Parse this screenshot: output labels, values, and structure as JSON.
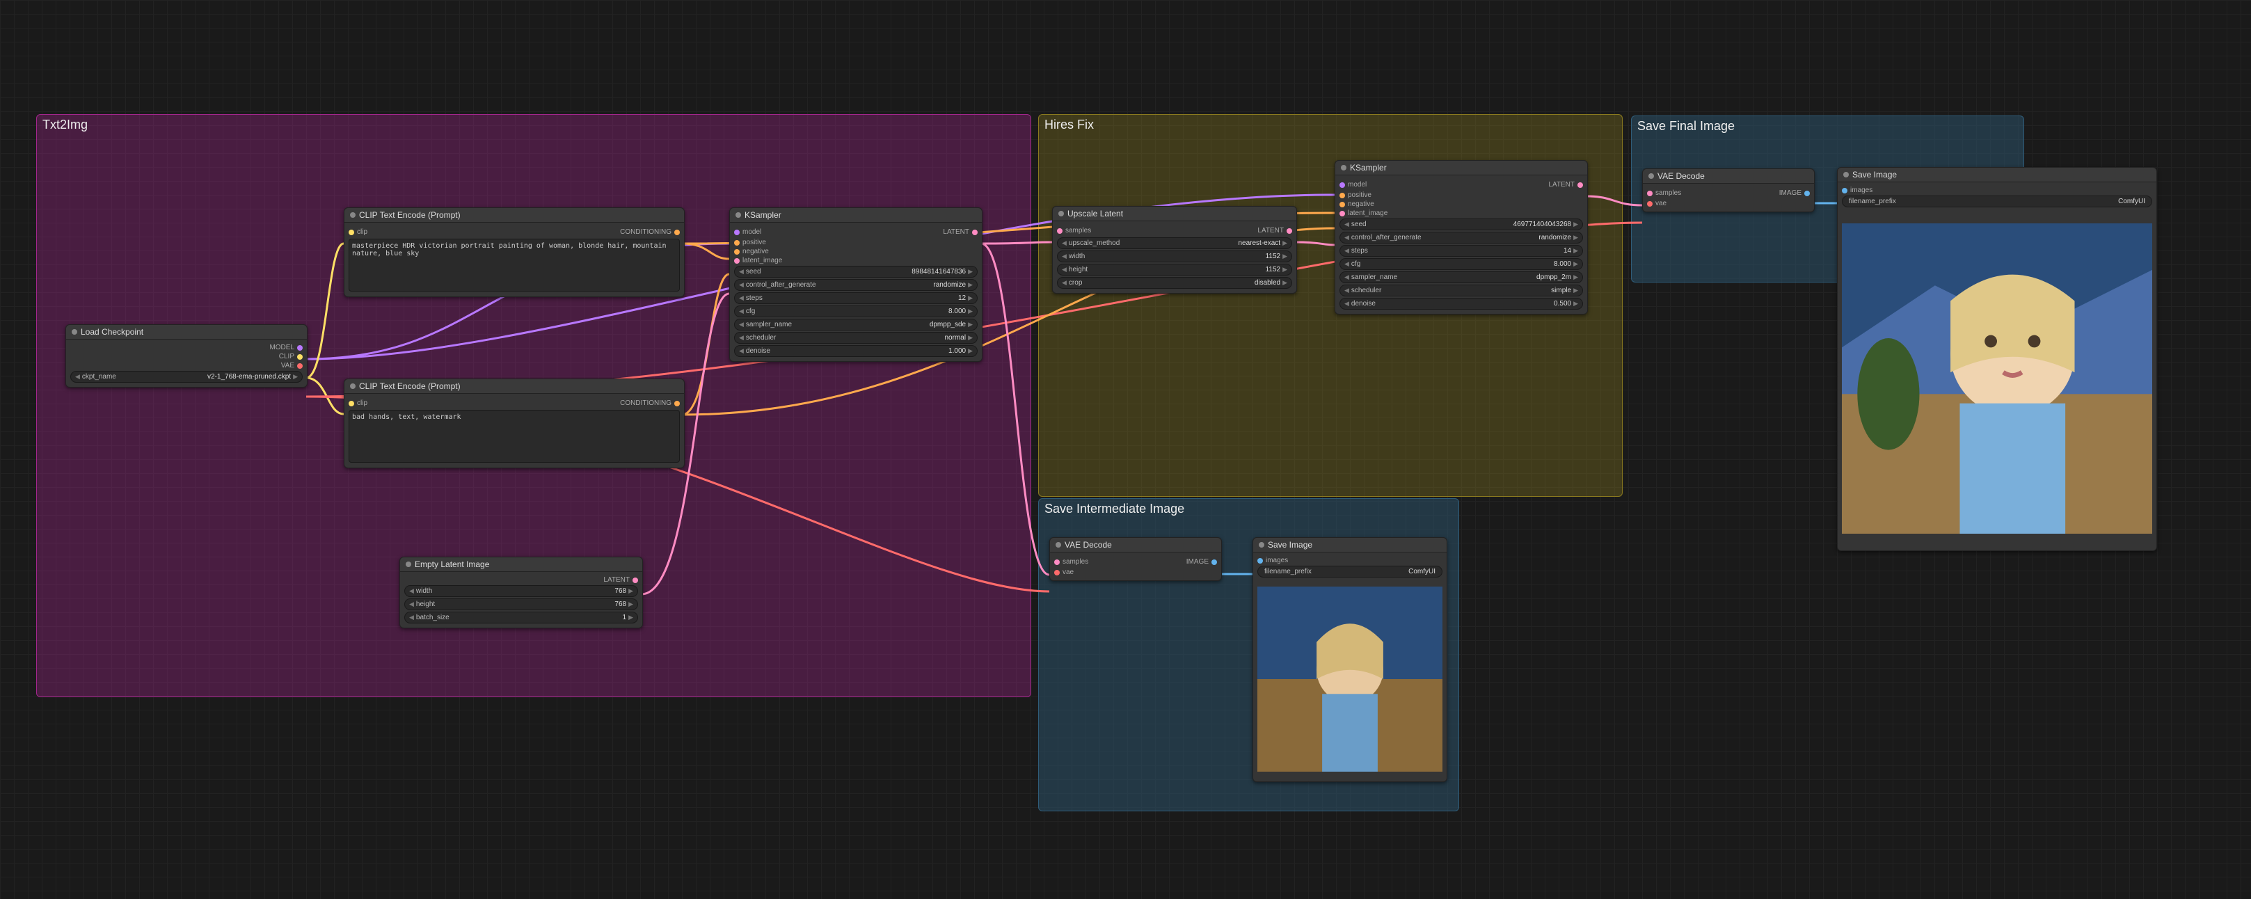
{
  "groups": {
    "txt2img": {
      "label": "Txt2Img",
      "color": "#a3268c"
    },
    "hiresfix": {
      "label": "Hires Fix",
      "color": "#8a7a1f"
    },
    "save_int": {
      "label": "Save Intermediate Image",
      "color": "#2f5d7a"
    },
    "save_final": {
      "label": "Save Final Image",
      "color": "#2f5d7a"
    }
  },
  "nodes": {
    "load_ckpt": {
      "title": "Load Checkpoint",
      "outputs": [
        "MODEL",
        "CLIP",
        "VAE"
      ],
      "widgets": {
        "ckpt_name": {
          "label": "ckpt_name",
          "value": "v2-1_768-ema-pruned.ckpt"
        }
      }
    },
    "clip_pos": {
      "title": "CLIP Text Encode (Prompt)",
      "inputs": [
        "clip"
      ],
      "outputs": [
        "CONDITIONING"
      ],
      "text": "masterpiece HDR victorian portrait painting of woman, blonde hair, mountain nature, blue sky"
    },
    "clip_neg": {
      "title": "CLIP Text Encode (Prompt)",
      "inputs": [
        "clip"
      ],
      "outputs": [
        "CONDITIONING"
      ],
      "text": "bad hands, text, watermark"
    },
    "empty_latent": {
      "title": "Empty Latent Image",
      "outputs": [
        "LATENT"
      ],
      "widgets": {
        "width": {
          "label": "width",
          "value": "768"
        },
        "height": {
          "label": "height",
          "value": "768"
        },
        "batch_size": {
          "label": "batch_size",
          "value": "1"
        }
      }
    },
    "ksampler1": {
      "title": "KSampler",
      "inputs": [
        "model",
        "positive",
        "negative",
        "latent_image"
      ],
      "outputs": [
        "LATENT"
      ],
      "widgets": {
        "seed": {
          "label": "seed",
          "value": "89848141647836"
        },
        "control_after_generate": {
          "label": "control_after_generate",
          "value": "randomize"
        },
        "steps": {
          "label": "steps",
          "value": "12"
        },
        "cfg": {
          "label": "cfg",
          "value": "8.000"
        },
        "sampler_name": {
          "label": "sampler_name",
          "value": "dpmpp_sde"
        },
        "scheduler": {
          "label": "scheduler",
          "value": "normal"
        },
        "denoise": {
          "label": "denoise",
          "value": "1.000"
        }
      }
    },
    "upscale": {
      "title": "Upscale Latent",
      "inputs": [
        "samples"
      ],
      "outputs": [
        "LATENT"
      ],
      "widgets": {
        "upscale_method": {
          "label": "upscale_method",
          "value": "nearest-exact"
        },
        "width": {
          "label": "width",
          "value": "1152"
        },
        "height": {
          "label": "height",
          "value": "1152"
        },
        "crop": {
          "label": "crop",
          "value": "disabled"
        }
      }
    },
    "ksampler2": {
      "title": "KSampler",
      "inputs": [
        "model",
        "positive",
        "negative",
        "latent_image"
      ],
      "outputs": [
        "LATENT"
      ],
      "widgets": {
        "seed": {
          "label": "seed",
          "value": "469771404043268"
        },
        "control_after_generate": {
          "label": "control_after_generate",
          "value": "randomize"
        },
        "steps": {
          "label": "steps",
          "value": "14"
        },
        "cfg": {
          "label": "cfg",
          "value": "8.000"
        },
        "sampler_name": {
          "label": "sampler_name",
          "value": "dpmpp_2m"
        },
        "scheduler": {
          "label": "scheduler",
          "value": "simple"
        },
        "denoise": {
          "label": "denoise",
          "value": "0.500"
        }
      }
    },
    "vae_decode_int": {
      "title": "VAE Decode",
      "inputs": [
        "samples",
        "vae"
      ],
      "outputs": [
        "IMAGE"
      ]
    },
    "save_int": {
      "title": "Save Image",
      "inputs": [
        "images"
      ],
      "widgets": {
        "filename_prefix": {
          "label": "filename_prefix",
          "value": "ComfyUI"
        }
      }
    },
    "vae_decode_final": {
      "title": "VAE Decode",
      "inputs": [
        "samples",
        "vae"
      ],
      "outputs": [
        "IMAGE"
      ]
    },
    "save_final": {
      "title": "Save Image",
      "inputs": [
        "images"
      ],
      "widgets": {
        "filename_prefix": {
          "label": "filename_prefix",
          "value": "ComfyUI"
        }
      }
    }
  },
  "arrows": {
    "left": "◀",
    "right": "▶"
  }
}
